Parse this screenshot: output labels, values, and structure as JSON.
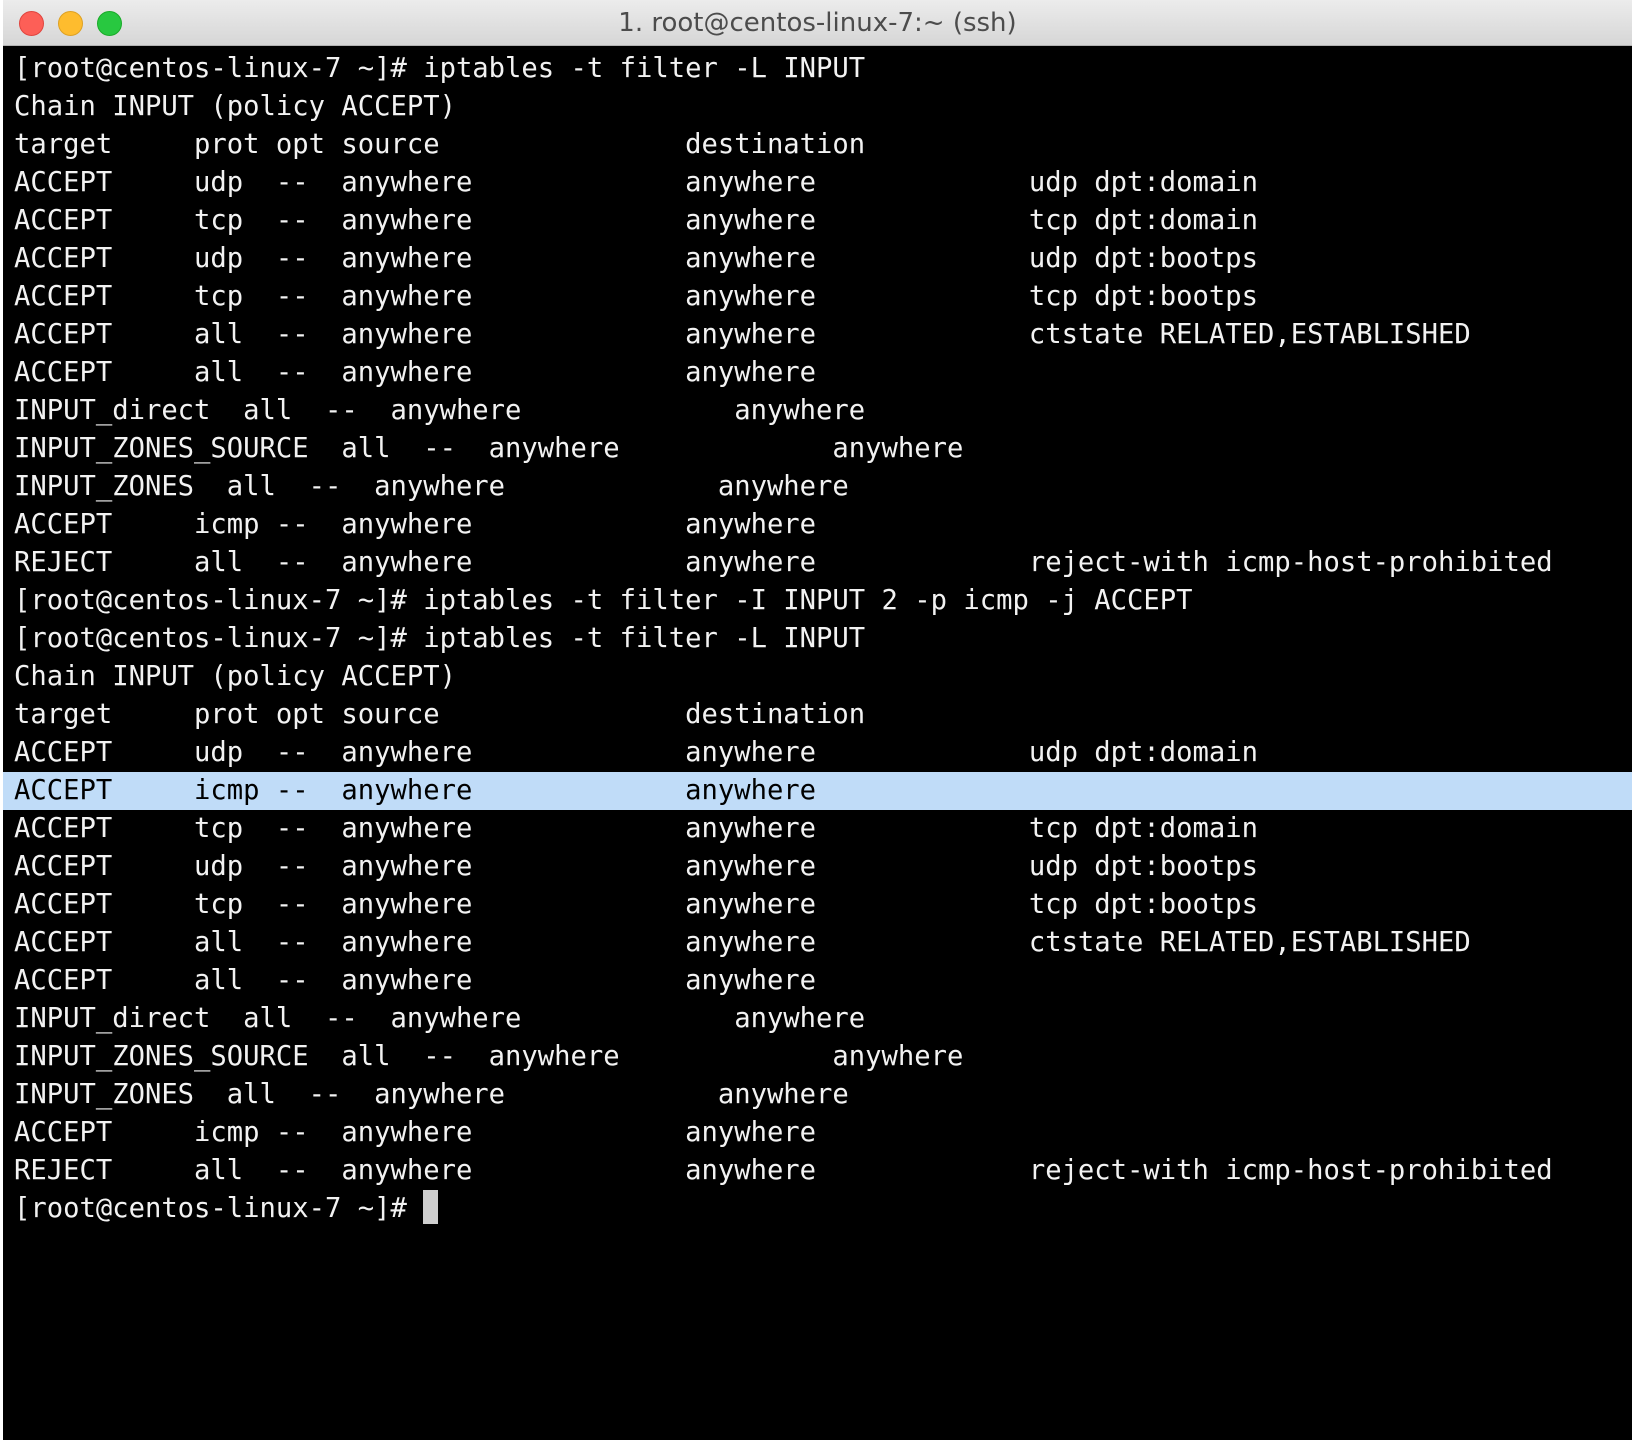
{
  "window": {
    "title": "1. root@centos-linux-7:~ (ssh)"
  },
  "terminal": {
    "selection_color": "#c0dcf8",
    "lines": [
      "[root@centos-linux-7 ~]# iptables -t filter -L INPUT",
      "Chain INPUT (policy ACCEPT)",
      "target     prot opt source               destination",
      "ACCEPT     udp  --  anywhere             anywhere             udp dpt:domain",
      "ACCEPT     tcp  --  anywhere             anywhere             tcp dpt:domain",
      "ACCEPT     udp  --  anywhere             anywhere             udp dpt:bootps",
      "ACCEPT     tcp  --  anywhere             anywhere             tcp dpt:bootps",
      "ACCEPT     all  --  anywhere             anywhere             ctstate RELATED,ESTABLISHED",
      "ACCEPT     all  --  anywhere             anywhere",
      "INPUT_direct  all  --  anywhere             anywhere",
      "INPUT_ZONES_SOURCE  all  --  anywhere             anywhere",
      "INPUT_ZONES  all  --  anywhere             anywhere",
      "ACCEPT     icmp --  anywhere             anywhere",
      "REJECT     all  --  anywhere             anywhere             reject-with icmp-host-prohibited",
      "[root@centos-linux-7 ~]# iptables -t filter -I INPUT 2 -p icmp -j ACCEPT",
      "[root@centos-linux-7 ~]# iptables -t filter -L INPUT",
      "Chain INPUT (policy ACCEPT)",
      "target     prot opt source               destination",
      "ACCEPT     udp  --  anywhere             anywhere             udp dpt:domain",
      "ACCEPT     icmp --  anywhere             anywhere",
      "ACCEPT     tcp  --  anywhere             anywhere             tcp dpt:domain",
      "ACCEPT     udp  --  anywhere             anywhere             udp dpt:bootps",
      "ACCEPT     tcp  --  anywhere             anywhere             tcp dpt:bootps",
      "ACCEPT     all  --  anywhere             anywhere             ctstate RELATED,ESTABLISHED",
      "ACCEPT     all  --  anywhere             anywhere",
      "INPUT_direct  all  --  anywhere             anywhere",
      "INPUT_ZONES_SOURCE  all  --  anywhere             anywhere",
      "INPUT_ZONES  all  --  anywhere             anywhere",
      "ACCEPT     icmp --  anywhere             anywhere",
      "REJECT     all  --  anywhere             anywhere             reject-with icmp-host-prohibited"
    ],
    "prompt": "[root@centos-linux-7 ~]# "
  }
}
